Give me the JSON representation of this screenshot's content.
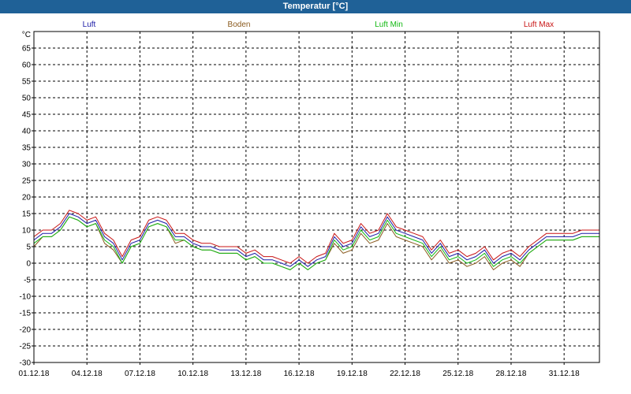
{
  "window": {
    "title": "Temperatur [°C]"
  },
  "chart_data": {
    "type": "line",
    "title": "Temperatur [°C]",
    "ylabel": "°C",
    "ylim": [
      -30,
      70
    ],
    "yticks": [
      -30,
      -25,
      -20,
      -15,
      -10,
      -5,
      0,
      5,
      10,
      15,
      20,
      25,
      30,
      35,
      40,
      45,
      50,
      55,
      60,
      65
    ],
    "xlim": [
      "2018-12-01",
      "2019-01-02"
    ],
    "xticks": [
      {
        "date": "2018-12-01",
        "label": "01.12.18"
      },
      {
        "date": "2018-12-04",
        "label": "04.12.18"
      },
      {
        "date": "2018-12-07",
        "label": "07.12.18"
      },
      {
        "date": "2018-12-10",
        "label": "10.12.18"
      },
      {
        "date": "2018-12-13",
        "label": "13.12.18"
      },
      {
        "date": "2018-12-16",
        "label": "16.12.18"
      },
      {
        "date": "2018-12-19",
        "label": "19.12.18"
      },
      {
        "date": "2018-12-22",
        "label": "22.12.18"
      },
      {
        "date": "2018-12-25",
        "label": "25.12.18"
      },
      {
        "date": "2018-12-28",
        "label": "28.12.18"
      },
      {
        "date": "2018-12-31",
        "label": "31.12.18"
      }
    ],
    "grid": true,
    "legend_position": "top",
    "x": [
      "2018-12-01 00:00",
      "2018-12-01 12:00",
      "2018-12-02 00:00",
      "2018-12-02 12:00",
      "2018-12-03 00:00",
      "2018-12-03 12:00",
      "2018-12-04 00:00",
      "2018-12-04 12:00",
      "2018-12-05 00:00",
      "2018-12-05 12:00",
      "2018-12-06 00:00",
      "2018-12-06 12:00",
      "2018-12-07 00:00",
      "2018-12-07 12:00",
      "2018-12-08 00:00",
      "2018-12-08 12:00",
      "2018-12-09 00:00",
      "2018-12-09 12:00",
      "2018-12-10 00:00",
      "2018-12-10 12:00",
      "2018-12-11 00:00",
      "2018-12-11 12:00",
      "2018-12-12 00:00",
      "2018-12-12 12:00",
      "2018-12-13 00:00",
      "2018-12-13 12:00",
      "2018-12-14 00:00",
      "2018-12-14 12:00",
      "2018-12-15 00:00",
      "2018-12-15 12:00",
      "2018-12-16 00:00",
      "2018-12-16 12:00",
      "2018-12-17 00:00",
      "2018-12-17 12:00",
      "2018-12-18 00:00",
      "2018-12-18 12:00",
      "2018-12-19 00:00",
      "2018-12-19 12:00",
      "2018-12-20 00:00",
      "2018-12-20 12:00",
      "2018-12-21 00:00",
      "2018-12-21 12:00",
      "2018-12-22 00:00",
      "2018-12-22 12:00",
      "2018-12-23 00:00",
      "2018-12-23 12:00",
      "2018-12-24 00:00",
      "2018-12-24 12:00",
      "2018-12-25 00:00",
      "2018-12-25 12:00",
      "2018-12-26 00:00",
      "2018-12-26 12:00",
      "2018-12-27 00:00",
      "2018-12-27 12:00",
      "2018-12-28 00:00",
      "2018-12-28 12:00",
      "2018-12-29 00:00",
      "2018-12-29 12:00",
      "2018-12-30 00:00",
      "2018-12-30 12:00",
      "2018-12-31 00:00",
      "2018-12-31 12:00",
      "2019-01-01 00:00",
      "2019-01-01 12:00",
      "2019-01-02 00:00"
    ],
    "series": [
      {
        "name": "Luft",
        "color": "#1a1aa6",
        "values": [
          7,
          9,
          9,
          11,
          15,
          14,
          12,
          13,
          8,
          6,
          1,
          6,
          7,
          12,
          13,
          12,
          8,
          8,
          6,
          5,
          5,
          4,
          4,
          4,
          2,
          3,
          1,
          1,
          0,
          -1,
          1,
          -1,
          1,
          2,
          8,
          5,
          6,
          11,
          8,
          9,
          14,
          10,
          9,
          8,
          7,
          3,
          6,
          2,
          3,
          1,
          2,
          4,
          0,
          2,
          3,
          1,
          4,
          6,
          8,
          8,
          8,
          8,
          9,
          9,
          9
        ]
      },
      {
        "name": "Boden",
        "color": "#8a5a1e",
        "values": [
          5,
          8,
          8,
          10,
          14,
          13,
          11,
          12,
          6,
          4,
          0,
          5,
          6,
          11,
          12,
          11,
          6,
          7,
          5,
          4,
          4,
          3,
          3,
          3,
          1,
          2,
          0,
          0,
          -1,
          -2,
          0,
          -2,
          0,
          1,
          6,
          3,
          4,
          9,
          6,
          7,
          12,
          8,
          7,
          6,
          5,
          1,
          4,
          0,
          1,
          -1,
          0,
          2,
          -2,
          0,
          1,
          -1,
          3,
          5,
          7,
          7,
          7,
          7,
          8,
          8,
          8
        ]
      },
      {
        "name": "Luft Min",
        "color": "#12b812",
        "values": [
          6,
          8,
          8,
          10,
          14,
          13,
          11,
          12,
          7,
          5,
          0,
          5,
          6,
          11,
          12,
          11,
          7,
          7,
          5,
          4,
          4,
          3,
          3,
          3,
          1,
          2,
          0,
          0,
          -1,
          -2,
          0,
          -2,
          0,
          1,
          7,
          4,
          5,
          10,
          7,
          8,
          13,
          9,
          8,
          7,
          6,
          2,
          5,
          1,
          2,
          0,
          1,
          3,
          -1,
          1,
          2,
          0,
          3,
          5,
          7,
          7,
          7,
          7,
          8,
          8,
          8
        ]
      },
      {
        "name": "Luft Max",
        "color": "#c81414",
        "values": [
          8,
          10,
          10,
          12,
          16,
          15,
          13,
          14,
          9,
          7,
          2,
          7,
          8,
          13,
          14,
          13,
          9,
          9,
          7,
          6,
          6,
          5,
          5,
          5,
          3,
          4,
          2,
          2,
          1,
          0,
          2,
          0,
          2,
          3,
          9,
          6,
          7,
          12,
          9,
          10,
          15,
          11,
          10,
          9,
          8,
          4,
          7,
          3,
          4,
          2,
          3,
          5,
          1,
          3,
          4,
          2,
          5,
          7,
          9,
          9,
          9,
          9,
          10,
          10,
          10
        ]
      }
    ]
  }
}
